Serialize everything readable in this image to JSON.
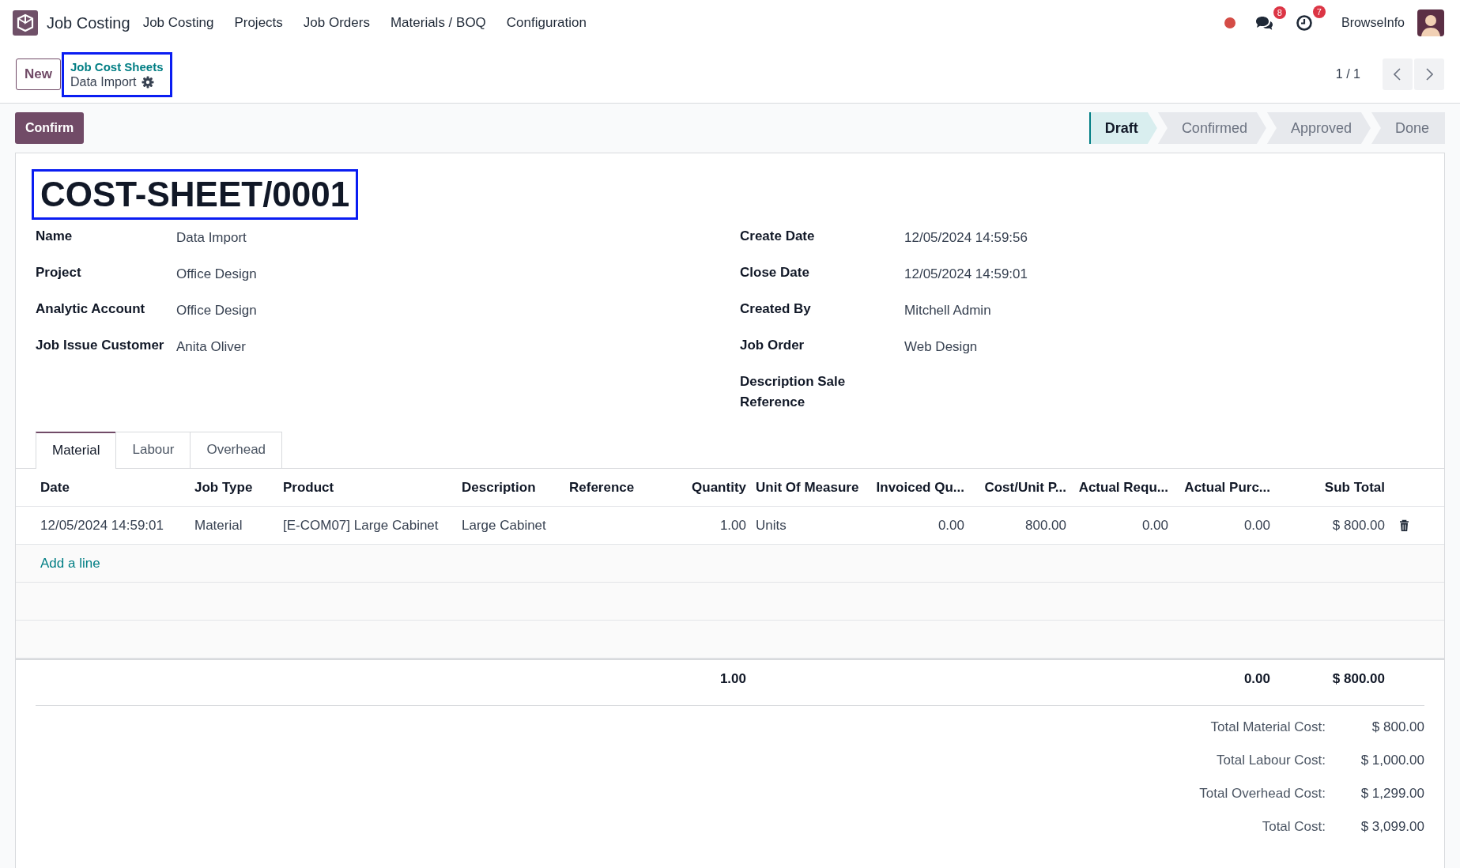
{
  "navbar": {
    "app_name": "Job Costing",
    "menu": [
      "Job Costing",
      "Projects",
      "Job Orders",
      "Materials / BOQ",
      "Configuration"
    ],
    "messages_badge": "8",
    "activities_badge": "7",
    "company": "BrowseInfo"
  },
  "control_panel": {
    "new_button": "New",
    "breadcrumb": {
      "parent": "Job Cost Sheets",
      "current": "Data Import",
      "highlighted": true
    },
    "pager": "1 / 1"
  },
  "action_button": "Confirm",
  "statusbar": [
    {
      "label": "Draft",
      "selected": true
    },
    {
      "label": "Confirmed",
      "selected": false
    },
    {
      "label": "Approved",
      "selected": false
    },
    {
      "label": "Done",
      "selected": false
    }
  ],
  "title": {
    "text": "COST-SHEET/0001",
    "highlighted": true
  },
  "fields_left": [
    {
      "label": "Name",
      "value": "Data Import"
    },
    {
      "label": "Project",
      "value": "Office Design"
    },
    {
      "label": "Analytic Account",
      "value": "Office Design"
    },
    {
      "label": "Job Issue Customer",
      "value": "Anita Oliver"
    }
  ],
  "fields_right": [
    {
      "label": "Create Date",
      "value": "12/05/2024 14:59:56"
    },
    {
      "label": "Close Date",
      "value": "12/05/2024 14:59:01"
    },
    {
      "label": "Created By",
      "value": "Mitchell Admin"
    },
    {
      "label": "Job Order",
      "value": "Web Design"
    },
    {
      "label": "Description Sale Reference"
    }
  ],
  "tabs": [
    {
      "label": "Material",
      "selected": true
    },
    {
      "label": "Labour",
      "selected": false
    },
    {
      "label": "Overhead",
      "selected": false
    }
  ],
  "table": {
    "columns": [
      "Date",
      "Job Type",
      "Product",
      "Description",
      "Reference",
      "Quantity",
      "Unit Of Measure",
      "Invoiced Qu...",
      "Cost/Unit P...",
      "Actual Requ...",
      "Actual Purc...",
      "Sub Total"
    ],
    "rows": [
      {
        "date": "12/05/2024 14:59:01",
        "job_type": "Material",
        "product": "[E-COM07] Large Cabinet",
        "description": "Large Cabinet",
        "quantity": "1.00",
        "unit_of_measure": "Units",
        "invoiced_qty": "0.00",
        "cost_unit_price": "800.00",
        "actual_requ": "0.00",
        "actual_purc": "0.00",
        "sub_total": "$ 800.00"
      }
    ],
    "add_line": "Add a line",
    "totals": {
      "quantity": "1.00",
      "actual_purc": "0.00",
      "sub_total": "$ 800.00"
    }
  },
  "summary": [
    {
      "label": "Total Material Cost:",
      "value": "$ 800.00"
    },
    {
      "label": "Total Labour Cost:",
      "value": "$ 1,000.00"
    },
    {
      "label": "Total Overhead Cost:",
      "value": "$ 1,299.00"
    },
    {
      "label": "Total Cost:",
      "value": "$ 3,099.00"
    }
  ]
}
